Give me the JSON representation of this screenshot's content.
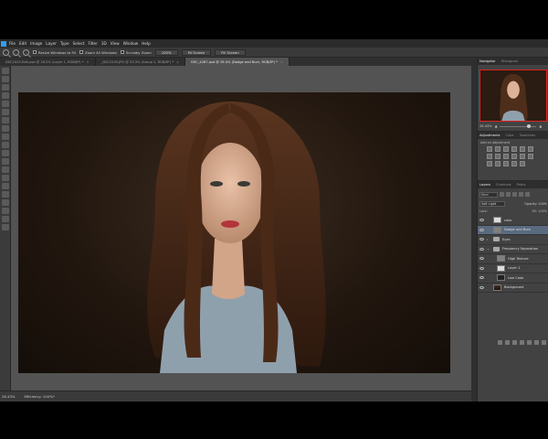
{
  "menu": [
    "Ps",
    "File",
    "Edit",
    "Image",
    "Layer",
    "Type",
    "Select",
    "Filter",
    "3D",
    "View",
    "Window",
    "Help"
  ],
  "options": {
    "resize_windows": "Resize Windows to Fit",
    "zoom_all_windows": "Zoom All Windows",
    "scrubby_zoom": "Scrubby Zoom",
    "btn_100": "100%",
    "btn_fit": "Fit Screen",
    "btn_fill": "Fill Screen"
  },
  "tabs": [
    {
      "label": "DSC2415-Edit.psd @ 16.2% (Layer 1, RGB/8*) *",
      "active": false
    },
    {
      "label": "_DSC2245.JPG @ 33.3% (Group 2, RGB/8*) *",
      "active": false
    },
    {
      "label": "DSC_4287.psd @ 26.4% (Dodge and Burn, RGB/8*) *",
      "active": true
    }
  ],
  "navigator": {
    "tabs": [
      "Navigator",
      "Histogram"
    ],
    "zoom": "26.43%"
  },
  "adjustments": {
    "tabs": [
      "Adjustments",
      "Color",
      "Swatches"
    ],
    "hint": "Add an adjustment"
  },
  "layers_panel": {
    "tabs": [
      "Layers",
      "Channels",
      "Paths"
    ],
    "kind": "Kind",
    "blend_mode": "Soft Light",
    "opacity_label": "Opacity:",
    "opacity": "100%",
    "lock_label": "Lock:",
    "fill_label": "Fill:",
    "fill": "100%",
    "layers": [
      {
        "name": "color",
        "thumb": "white",
        "selected": false,
        "indent": 0
      },
      {
        "name": "Dodge and Burn",
        "thumb": "grey",
        "selected": true,
        "indent": 0
      },
      {
        "name": "Eyes",
        "thumb": "folder",
        "selected": false,
        "indent": 0
      },
      {
        "name": "Frequency Separation",
        "thumb": "folder",
        "selected": false,
        "indent": 0
      },
      {
        "name": "High Texture",
        "thumb": "grey",
        "selected": false,
        "indent": 1
      },
      {
        "name": "Layer 1",
        "thumb": "white",
        "selected": false,
        "indent": 1
      },
      {
        "name": "Low Color",
        "thumb": "dark",
        "selected": false,
        "indent": 1
      },
      {
        "name": "Background",
        "thumb": "photo",
        "selected": false,
        "indent": 0
      }
    ]
  },
  "status": {
    "zoom": "26.43%",
    "efficiency": "Efficiency: 100%*"
  },
  "colors": {
    "ui_dark": "#2b2b2b",
    "ui_mid": "#535353",
    "selection": "#5a6b80",
    "nav_frame": "#dd2222"
  }
}
